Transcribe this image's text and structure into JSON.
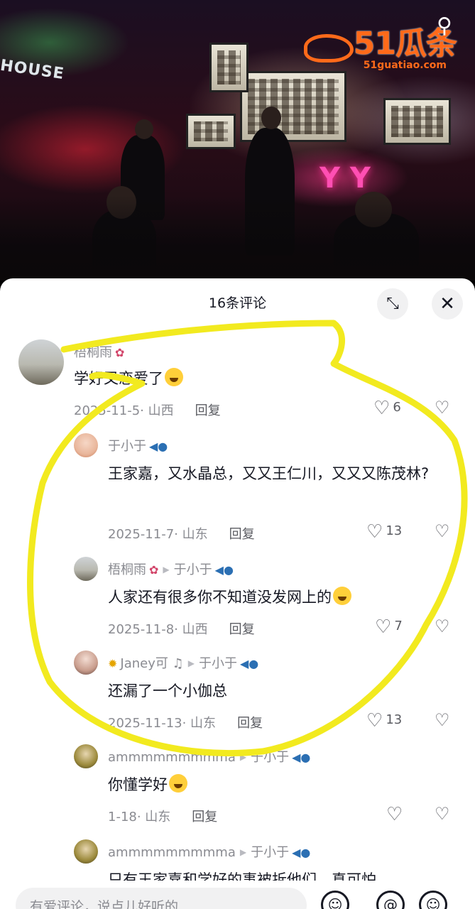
{
  "watermark": {
    "logo": "51瓜条",
    "url": "51guatiao.com"
  },
  "video": {
    "sign_text": "HOUSE",
    "neon_text": "Y Y"
  },
  "sheet": {
    "title": "16条评论",
    "expand_icon": "expand-icon",
    "close_icon": "close-icon"
  },
  "comments": [
    {
      "name": "梧桐雨",
      "text": "学好又恋爱了",
      "date": "2025-11-5· 山西",
      "reply": "回复",
      "likes": "6"
    },
    {
      "name": "于小于",
      "text": "王家嘉，又水晶总，又又王仁川，又又又陈茂林?",
      "date": "2025-11-7· 山东",
      "reply": "回复",
      "likes": "13"
    },
    {
      "name": "梧桐雨",
      "reply_to": "于小于",
      "text": "人家还有很多你不知道没发网上的",
      "date": "2025-11-8· 山西",
      "reply": "回复",
      "likes": "7"
    },
    {
      "name": "Janey可",
      "reply_to": "于小于",
      "text": "还漏了一个小伽总",
      "date": "2025-11-13· 山东",
      "reply": "回复",
      "likes": "13"
    },
    {
      "name": "ammmmmmmmma",
      "reply_to": "于小于",
      "text": "你懂学好",
      "date": "1-18· 山东",
      "reply": "回复",
      "likes": ""
    },
    {
      "name": "ammmmmmmmma",
      "reply_to": "于小于",
      "text": "只有王家嘉和学好的事被拆他们…真可怕",
      "date": "",
      "reply": "",
      "likes": ""
    }
  ],
  "input": {
    "placeholder": "有爱评论，说点儿好听的"
  },
  "colors": {
    "highlight": "#f2ea1f",
    "watermark": "#ff6a1a"
  }
}
